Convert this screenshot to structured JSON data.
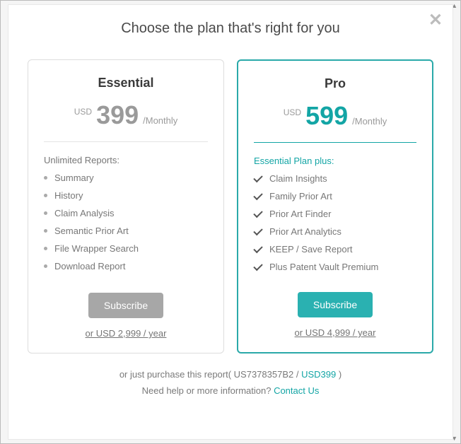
{
  "title": "Choose the plan that's right for you",
  "close_icon": "✕",
  "plans": {
    "essential": {
      "name": "Essential",
      "currency": "USD",
      "price": "399",
      "period": "/Monthly",
      "list_title": "Unlimited Reports:",
      "features": [
        "Summary",
        "History",
        "Claim Analysis",
        "Semantic Prior Art",
        "File Wrapper Search",
        "Download Report"
      ],
      "button": "Subscribe",
      "yearly": "or USD 2,999 / year"
    },
    "pro": {
      "name": "Pro",
      "currency": "USD",
      "price": "599",
      "period": "/Monthly",
      "list_title": "Essential Plan plus:",
      "features": [
        "Claim Insights",
        "Family Prior Art",
        "Prior Art Finder",
        "Prior Art Analytics",
        "KEEP / Save Report",
        "Plus Patent Vault Premium"
      ],
      "button": "Subscribe",
      "yearly": "or USD 4,999 / year"
    }
  },
  "footer": {
    "purchase_prefix": "or just purchase this report( US7378357B2 / ",
    "purchase_price": "USD399",
    "purchase_suffix": " )",
    "help_prefix": "Need help or more information? ",
    "help_link": "Contact Us"
  }
}
